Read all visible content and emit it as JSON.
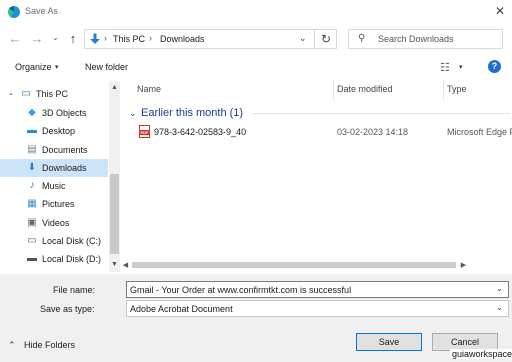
{
  "window": {
    "title": "Save As",
    "close_glyph": "✕"
  },
  "nav": {
    "back_glyph": "←",
    "forward_glyph": "→",
    "recent_glyph": "⌄",
    "up_glyph": "↑",
    "breadcrumb": [
      "This PC",
      "Downloads"
    ],
    "separator": "›",
    "dropdown_glyph": "⌄",
    "refresh_glyph": "↻",
    "search_glyph": "⚲",
    "search_placeholder": "Search Downloads"
  },
  "toolbar": {
    "organize_label": "Organize",
    "new_folder_label": "New folder",
    "dropdown_glyph": "▾",
    "view_glyph": "☷",
    "help_glyph": "?"
  },
  "sidebar": {
    "items": [
      {
        "label": "This PC",
        "icon": "computer-icon",
        "glyph": "▭",
        "color": "#2a6fb8",
        "chevron": "⌄"
      },
      {
        "label": "3D Objects",
        "icon": "3d-objects-icon",
        "glyph": "◆",
        "color": "#3aa0d8"
      },
      {
        "label": "Desktop",
        "icon": "desktop-folder-icon",
        "glyph": "▬",
        "color": "#2b8ad6"
      },
      {
        "label": "Documents",
        "icon": "documents-icon",
        "glyph": "▤",
        "color": "#6f7e8c"
      },
      {
        "label": "Downloads",
        "icon": "downloads-icon",
        "glyph": "⬇",
        "color": "#2d7bd1",
        "selected": true
      },
      {
        "label": "Music",
        "icon": "music-icon",
        "glyph": "♪",
        "color": "#2d7bd1"
      },
      {
        "label": "Pictures",
        "icon": "pictures-icon",
        "glyph": "▦",
        "color": "#3a8fd8"
      },
      {
        "label": "Videos",
        "icon": "videos-icon",
        "glyph": "▣",
        "color": "#5a6c80"
      },
      {
        "label": "Local Disk (C:)",
        "icon": "disk-c-icon",
        "glyph": "▭",
        "color": "#4a6a8a"
      },
      {
        "label": "Local Disk (D:)",
        "icon": "disk-d-icon",
        "glyph": "▬",
        "color": "#555555"
      }
    ],
    "scroll_up_glyph": "▲",
    "scroll_down_glyph": "▼"
  },
  "list": {
    "columns": [
      "Name",
      "Date modified",
      "Type"
    ],
    "group_title": "Earlier this month (1)",
    "group_chevron": "⌄",
    "files": [
      {
        "name": "978-3-642-02583-9_40",
        "date": "03-02-2023 14:18",
        "type": "Microsoft Edge P",
        "icon": "pdf-file-icon",
        "icon_text": "PDF"
      }
    ],
    "hscroll_left_glyph": "◀",
    "hscroll_right_glyph": "▶"
  },
  "form": {
    "file_name_label": "File name:",
    "file_name_value": "Gmail - Your Order at www.confirmtkt.com is successful",
    "save_type_label": "Save as type:",
    "save_type_value": "Adobe Acrobat Document",
    "dropdown_glyph": "⌄",
    "save_label": "Save",
    "cancel_label": "Cancel",
    "hide_folders_label": "Hide Folders",
    "hide_glyph": "⌃"
  },
  "watermark": "guiaworkspace",
  "colors": {
    "selected_bg": "#cce4f7",
    "accent": "#0078d7",
    "group_title": "#1e3a8a"
  }
}
